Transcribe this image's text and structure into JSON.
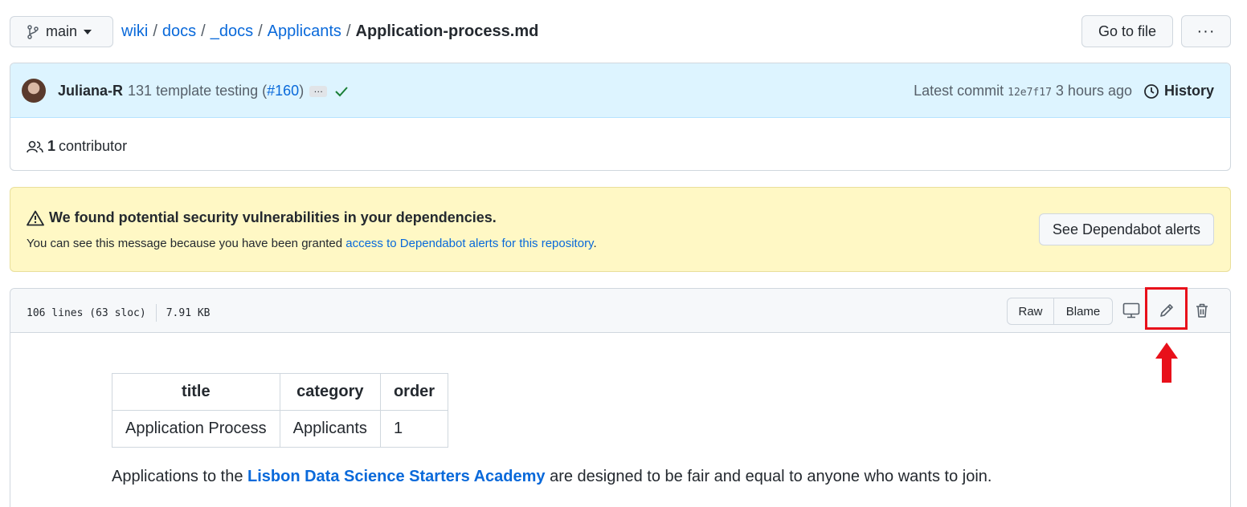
{
  "branch": {
    "label": "main"
  },
  "breadcrumb": {
    "repo": "wiki",
    "parts": [
      "docs",
      "_docs",
      "Applicants"
    ],
    "separator": "/",
    "file": "Application-process.md"
  },
  "top_actions": {
    "goto_file": "Go to file",
    "more": "···"
  },
  "commit": {
    "author": "Juliana-R",
    "message_pre": "131 template testing (",
    "pr": "#160",
    "message_post": ")",
    "ellipsis": "…",
    "latest_label": "Latest commit",
    "sha": "12e7f17",
    "time": "3 hours ago",
    "history": "History"
  },
  "contributors": {
    "count": "1",
    "label": "contributor"
  },
  "dependabot": {
    "title": "We found potential security vulnerabilities in your dependencies.",
    "message": "You can see this message because you have been granted ",
    "link": "access to Dependabot alerts for this repository",
    "message_end": ".",
    "button": "See Dependabot alerts"
  },
  "file": {
    "lines": "106 lines (63 sloc)",
    "size": "7.91 KB",
    "raw": "Raw",
    "blame": "Blame"
  },
  "frontmatter": {
    "headers": [
      "title",
      "category",
      "order"
    ],
    "row": [
      "Application Process",
      "Applicants",
      "1"
    ]
  },
  "intro": {
    "pre": "Applications to the ",
    "link": "Lisbon Data Science Starters Academy",
    "post": " are designed to be fair and equal to anyone who wants to join."
  },
  "colors": {
    "link": "#0969da",
    "highlight": "#e8101a",
    "success": "#1a7f37"
  }
}
